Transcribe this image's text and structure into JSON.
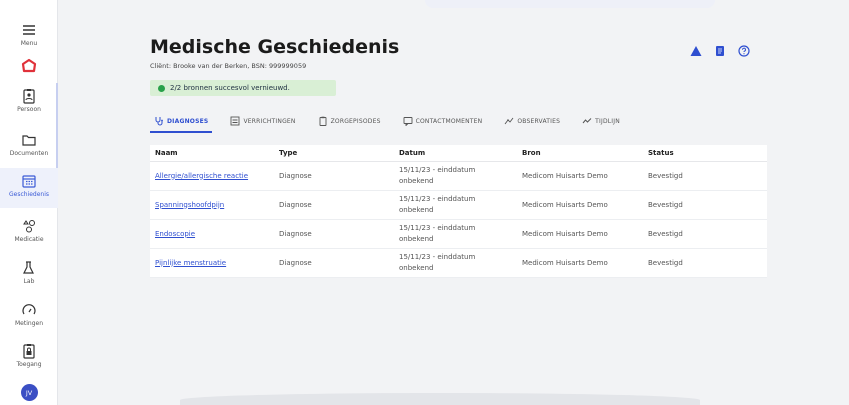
{
  "sidebar": {
    "menu_label": "Menu",
    "items": [
      {
        "label": "Persoon",
        "icon": "clipboard-person-icon"
      },
      {
        "label": "Documenten",
        "icon": "folder-icon"
      },
      {
        "label": "Geschiedenis",
        "icon": "calendar-icon",
        "active": true
      },
      {
        "label": "Medicatie",
        "icon": "pills-icon"
      },
      {
        "label": "Lab",
        "icon": "flask-icon"
      },
      {
        "label": "Metingen",
        "icon": "gauge-icon"
      },
      {
        "label": "Toegang",
        "icon": "clipboard-lock-icon"
      }
    ],
    "avatar_initials": "JV"
  },
  "header": {
    "title": "Medische Geschiedenis",
    "client_line": "Cliënt: Brooke van der Berken, BSN: 999999059",
    "banner": "2/2 bronnen succesvol vernieuwd."
  },
  "tabs": [
    {
      "label": "DIAGNOSES",
      "active": true
    },
    {
      "label": "VERRICHTINGEN"
    },
    {
      "label": "ZORGEPISODES"
    },
    {
      "label": "CONTACTMOMENTEN"
    },
    {
      "label": "OBSERVATIES"
    },
    {
      "label": "TIJDLIJN"
    }
  ],
  "table": {
    "headers": [
      "Naam",
      "Type",
      "Datum",
      "Bron",
      "Status"
    ],
    "rows": [
      {
        "naam": "Allergie/allergische reactie",
        "type": "Diagnose",
        "datum1": "15/11/23 - einddatum",
        "datum2": "onbekend",
        "bron": "Medicom Huisarts Demo",
        "status": "Bevestigd"
      },
      {
        "naam": "Spanningshoofdpijn",
        "type": "Diagnose",
        "datum1": "15/11/23 - einddatum",
        "datum2": "onbekend",
        "bron": "Medicom Huisarts Demo",
        "status": "Bevestigd"
      },
      {
        "naam": "Endoscopie",
        "type": "Diagnose",
        "datum1": "15/11/23 - einddatum",
        "datum2": "onbekend",
        "bron": "Medicom Huisarts Demo",
        "status": "Bevestigd"
      },
      {
        "naam": "Pijnlijke menstruatie",
        "type": "Diagnose",
        "datum1": "15/11/23 - einddatum",
        "datum2": "onbekend",
        "bron": "Medicom Huisarts Demo",
        "status": "Bevestigd"
      }
    ]
  },
  "colors": {
    "accent": "#2f4fd0",
    "logo": "#e0313a",
    "success": "#29a14a",
    "avatar": "#3b4fc4"
  }
}
